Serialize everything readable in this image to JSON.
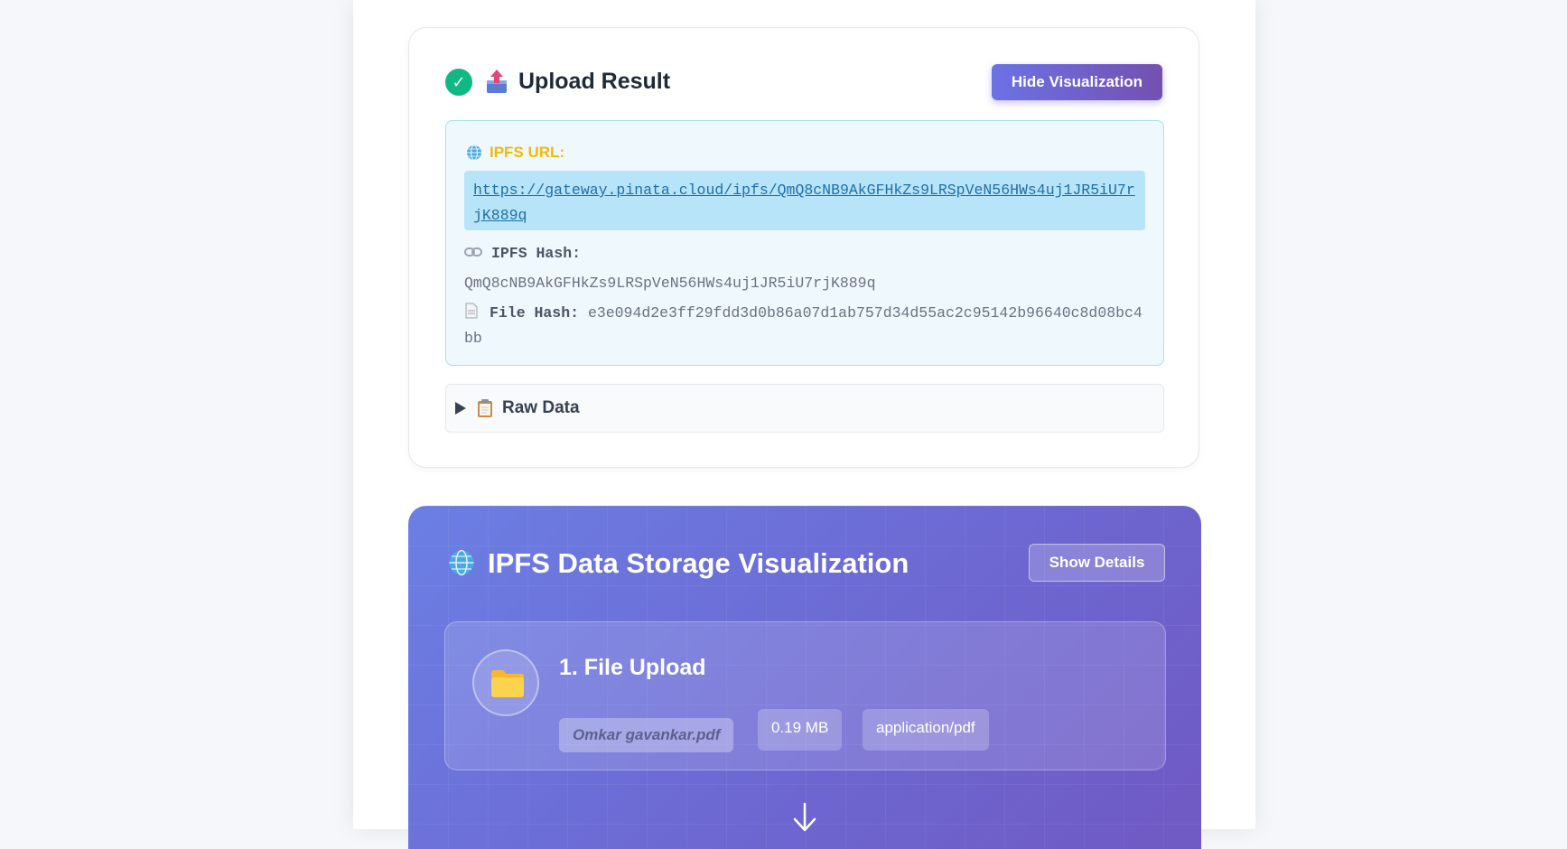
{
  "upload_result": {
    "title": "Upload Result",
    "hide_visualization_label": "Hide Visualization",
    "ipfs_url_label": "IPFS URL:",
    "ipfs_url": "https://gateway.pinata.cloud/ipfs/QmQ8cNB9AkGFHkZs9LRSpVeN56HWs4uj1JR5iU7rjK889q",
    "ipfs_hash_label": "IPFS Hash:",
    "ipfs_hash": "QmQ8cNB9AkGFHkZs9LRSpVeN56HWs4uj1JR5iU7rjK889q",
    "file_hash_label": "File Hash:",
    "file_hash": "e3e094d2e3ff29fdd3d0b86a07d1ab757d34d55ac2c95142b96640c8d08bc4bb",
    "raw_data_label": "Raw Data"
  },
  "visualization": {
    "title": "IPFS Data Storage Visualization",
    "show_details_label": "Show Details",
    "step": {
      "title": "1. File Upload",
      "file_name": "Omkar gavankar.pdf",
      "file_size": "0.19 MB",
      "file_type": "application/pdf"
    }
  },
  "icons": {
    "success": "check-circle-icon",
    "upload": "upload-box-icon",
    "globe": "globe-icon",
    "link": "link-icon",
    "document": "document-icon",
    "toggle": "triangle-right-icon",
    "clipboard": "clipboard-icon",
    "folder": "folder-icon",
    "arrow": "arrow-down-icon"
  },
  "colors": {
    "accent_start": "#6c72e5",
    "accent_end": "#7450b0",
    "success": "#10b981",
    "url_label": "#f0b90b",
    "url_text": "#1d6fa8"
  }
}
